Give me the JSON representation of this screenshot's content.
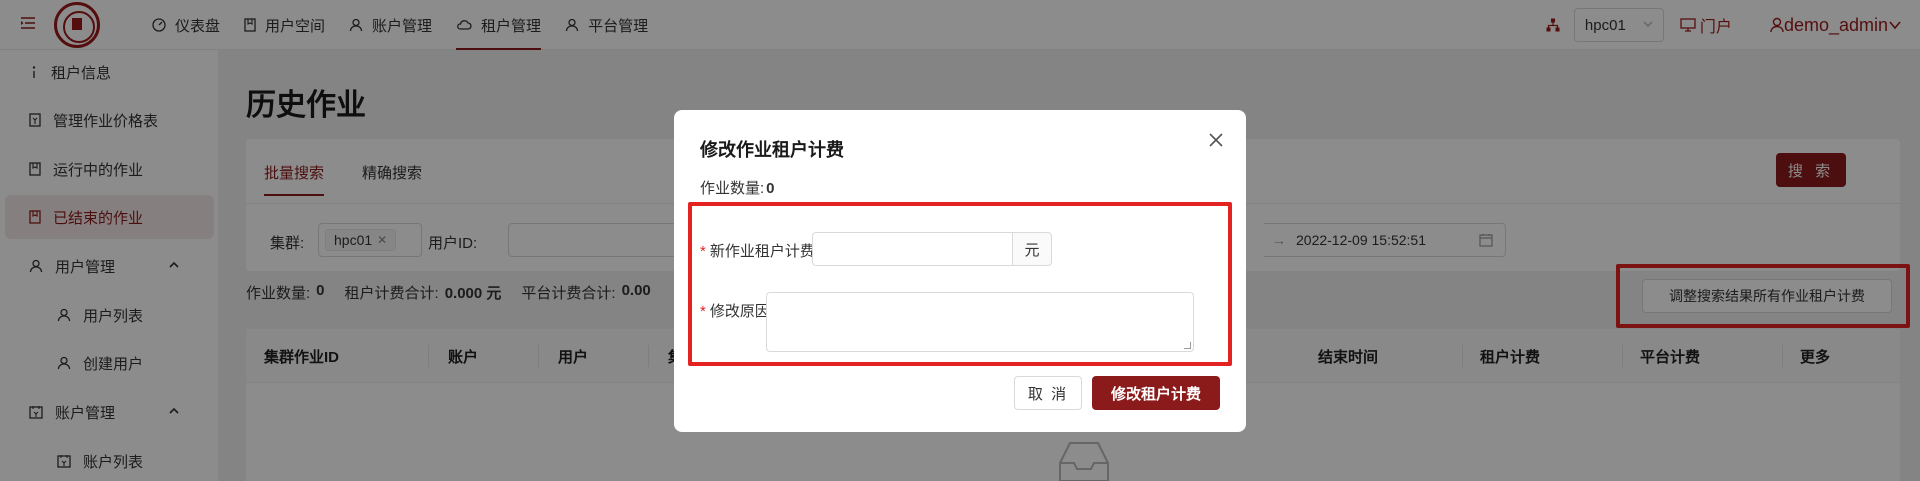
{
  "header": {
    "nav": [
      {
        "label": "仪表盘",
        "icon": "dashboard-icon"
      },
      {
        "label": "用户空间",
        "icon": "document-icon"
      },
      {
        "label": "账户管理",
        "icon": "user-icon"
      },
      {
        "label": "租户管理",
        "icon": "cloud-icon",
        "active": true
      },
      {
        "label": "平台管理",
        "icon": "user-icon"
      }
    ],
    "cluster_value": "hpc01",
    "portal_label": "门户",
    "user_label": "demo_admin"
  },
  "sidebar": {
    "items": [
      {
        "label": "租户信息"
      },
      {
        "label": "管理作业价格表"
      },
      {
        "label": "运行中的作业"
      },
      {
        "label": "已结束的作业",
        "active": true
      },
      {
        "label": "用户管理"
      },
      {
        "label": "用户列表"
      },
      {
        "label": "创建用户"
      },
      {
        "label": "账户管理"
      },
      {
        "label": "账户列表"
      }
    ]
  },
  "page": {
    "title": "历史作业",
    "tabs": [
      "批量搜索",
      "精确搜索"
    ],
    "search_label": "搜 索",
    "cluster_label": "集群:",
    "cluster_tag": "hpc01",
    "userid_label": "用户ID:",
    "date_end": "2022-12-09 15:52:51",
    "stats": {
      "job_count_label": "作业数量:",
      "job_count": "0",
      "tenant_fee_label": "租户计费合计:",
      "tenant_fee": "0.000 元",
      "platform_fee_label": "平台计费合计:",
      "platform_fee": "0.00"
    },
    "adjust_button": "调整搜索结果所有作业租户计费",
    "columns": [
      "集群作业ID",
      "账户",
      "用户",
      "集",
      "结束时间",
      "租户计费",
      "平台计费",
      "更多"
    ]
  },
  "modal": {
    "title": "修改作业租户计费",
    "count_label": "作业数量:",
    "count_value": "0",
    "fee_label": "新作业租户计费:",
    "fee_value": "",
    "fee_unit": "元",
    "reason_label": "修改原因:",
    "reason_value": "",
    "cancel_label": "取 消",
    "submit_label": "修改租户计费"
  },
  "colors": {
    "accent": "#8b1a1a",
    "highlight": "#e32222"
  }
}
